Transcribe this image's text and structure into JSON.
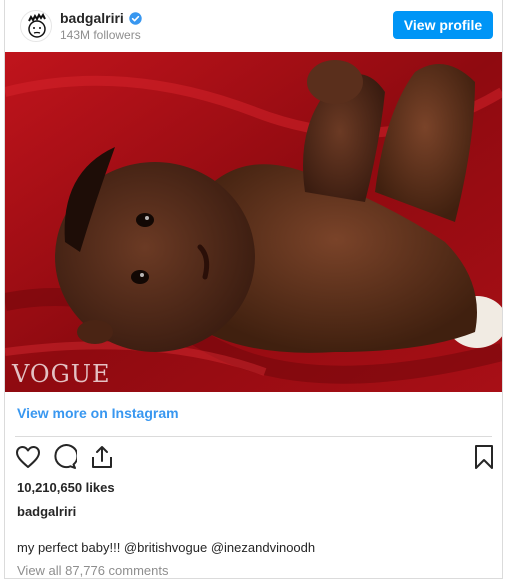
{
  "header": {
    "username": "badgalriri",
    "followers": "143M followers",
    "view_profile_label": "View profile"
  },
  "photo": {
    "watermark": "VOGUE"
  },
  "view_more_label": "View more on Instagram",
  "likes": "10,210,650 likes",
  "caption": {
    "username": "badgalriri",
    "text": "my perfect baby!!! @britishvogue @inezandvinoodh"
  },
  "comments_link": "View all 87,776 comments",
  "colors": {
    "accent": "#0095f6",
    "link": "#3897f0",
    "muted": "#8e8e8e",
    "backdrop": "#9a0b12"
  },
  "icons": [
    "avatar",
    "verified-badge-icon",
    "heart-icon",
    "comment-icon",
    "share-icon",
    "bookmark-icon"
  ]
}
